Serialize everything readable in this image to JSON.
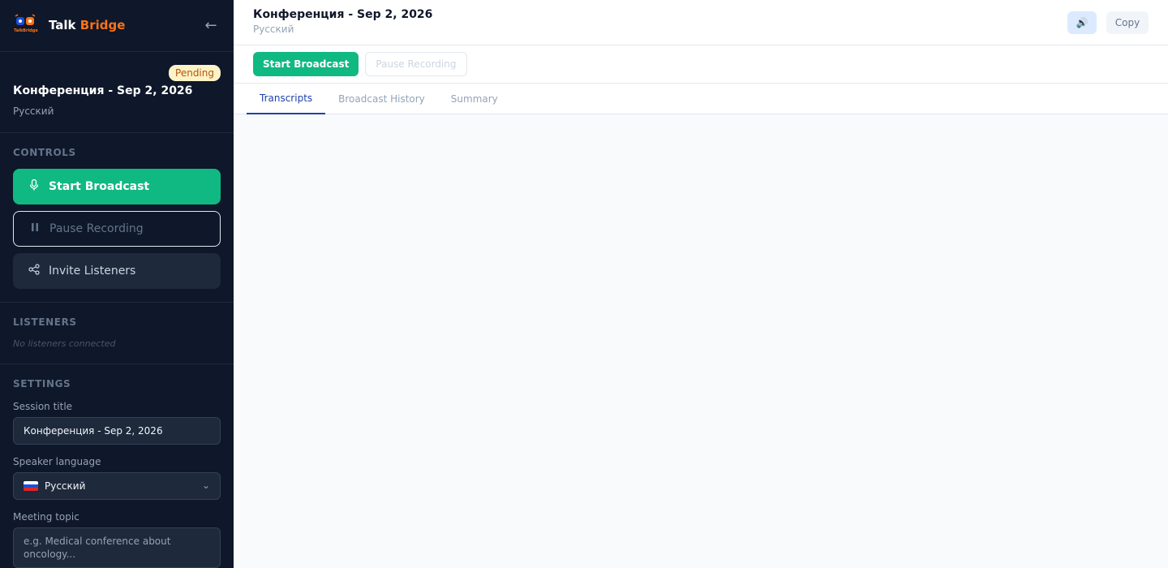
{
  "sidebar": {
    "brand": {
      "first": "Talk",
      "second": "Bridge",
      "logo_text": "TalkBridge"
    },
    "session": {
      "status": "Pending",
      "title": "Конференция - Sep 2, 2026",
      "language": "Русский"
    },
    "controls": {
      "label": "CONTROLS",
      "start_label": "Start Broadcast",
      "pause_label": "Pause Recording",
      "invite_label": "Invite Listeners"
    },
    "listeners": {
      "label": "LISTENERS",
      "empty_text": "No listeners connected"
    },
    "settings": {
      "label": "SETTINGS",
      "session_title_label": "Session title",
      "session_title_value": "Конференция - Sep 2, 2026",
      "speaker_language_label": "Speaker language",
      "speaker_language_value": "Русский",
      "meeting_topic_label": "Meeting topic",
      "meeting_topic_placeholder": "e.g. Medical conference about oncology..."
    }
  },
  "header": {
    "title": "Конференция - Sep 2, 2026",
    "language": "Русский",
    "speaker_icon": "🔊",
    "copy_label": "Copy"
  },
  "actionbar": {
    "start_label": "Start Broadcast",
    "pause_label": "Pause Recording"
  },
  "tabs": [
    {
      "label": "Transcripts",
      "active": true
    },
    {
      "label": "Broadcast History",
      "active": false
    },
    {
      "label": "Summary",
      "active": false
    }
  ],
  "colors": {
    "accent_green": "#10b981",
    "brand_orange": "#f97316",
    "sidebar_bg": "#0f172a",
    "active_tab": "#1e40af"
  }
}
